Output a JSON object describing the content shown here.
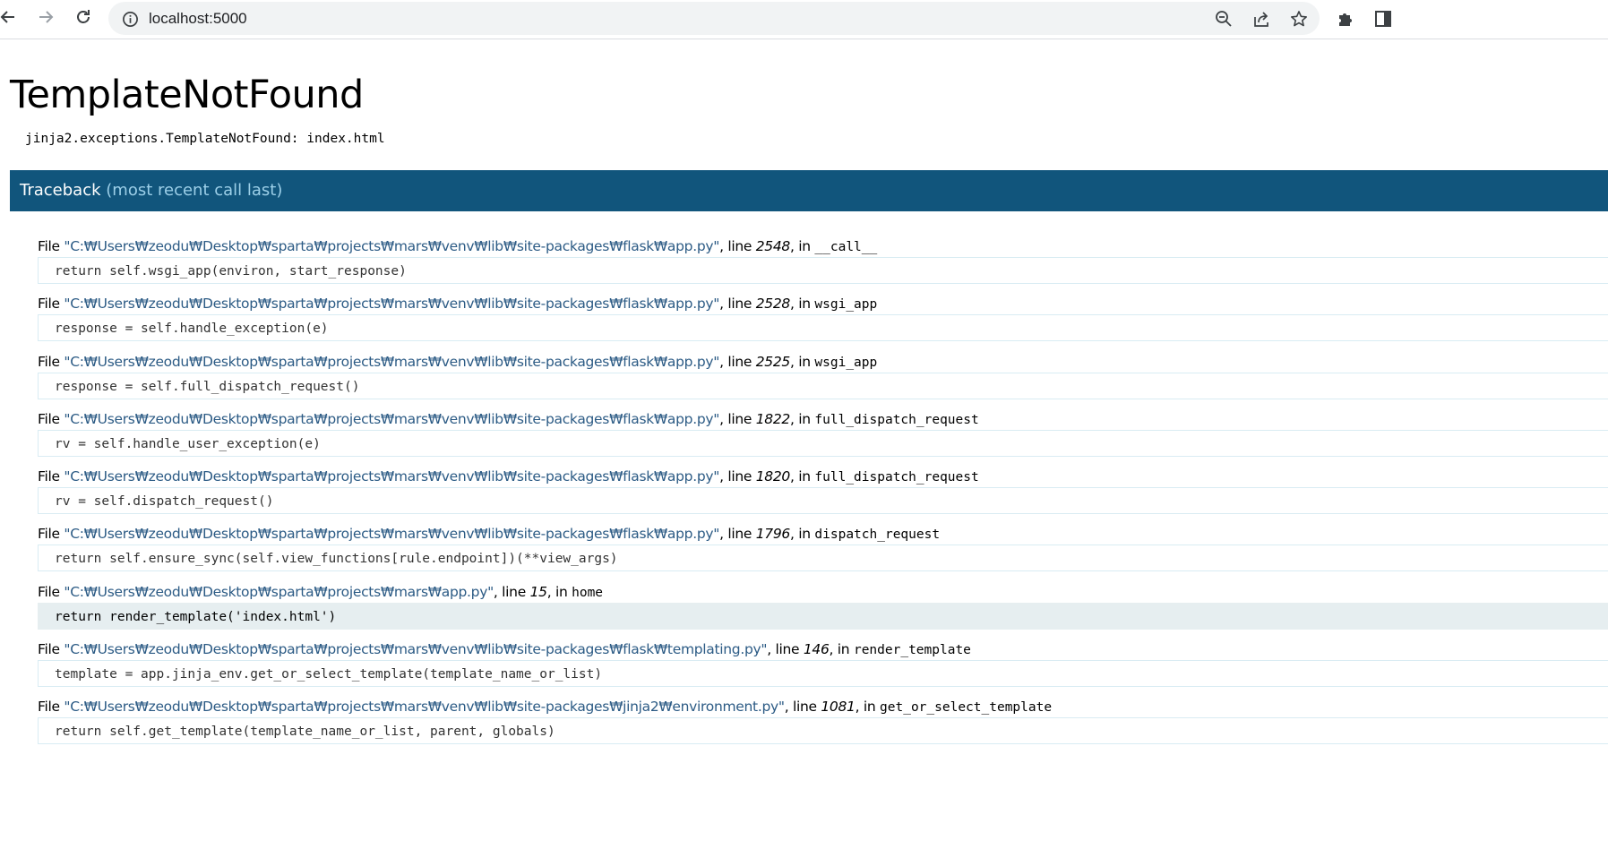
{
  "browser": {
    "url": "localhost:5000",
    "icons": {
      "back": "arrow-left-icon",
      "forward": "arrow-right-icon",
      "reload": "reload-icon",
      "site_info": "info-icon",
      "zoom": "zoom-out-icon",
      "share": "share-icon",
      "bookmark": "star-icon",
      "extensions": "puzzle-icon",
      "side_panel": "side-panel-icon"
    }
  },
  "error": {
    "title": "TemplateNotFound",
    "message": "jinja2.exceptions.TemplateNotFound: index.html"
  },
  "traceback": {
    "label": "Traceback",
    "note": "(most recent call last)",
    "frames": [
      {
        "file_prefix": "File ",
        "path": "\"C:₩Users₩zeodu₩Desktop₩sparta₩projects₩mars₩venv₩lib₩site-packages₩flask₩app.py\"",
        "line_label": ", line ",
        "line": "2548",
        "in_label": ", in ",
        "func": "__call__",
        "code": "return self.wsgi_app(environ, start_response)",
        "current": false
      },
      {
        "file_prefix": "File ",
        "path": "\"C:₩Users₩zeodu₩Desktop₩sparta₩projects₩mars₩venv₩lib₩site-packages₩flask₩app.py\"",
        "line_label": ", line ",
        "line": "2528",
        "in_label": ", in ",
        "func": "wsgi_app",
        "code": "response = self.handle_exception(e)",
        "current": false
      },
      {
        "file_prefix": "File ",
        "path": "\"C:₩Users₩zeodu₩Desktop₩sparta₩projects₩mars₩venv₩lib₩site-packages₩flask₩app.py\"",
        "line_label": ", line ",
        "line": "2525",
        "in_label": ", in ",
        "func": "wsgi_app",
        "code": "response = self.full_dispatch_request()",
        "current": false
      },
      {
        "file_prefix": "File ",
        "path": "\"C:₩Users₩zeodu₩Desktop₩sparta₩projects₩mars₩venv₩lib₩site-packages₩flask₩app.py\"",
        "line_label": ", line ",
        "line": "1822",
        "in_label": ", in ",
        "func": "full_dispatch_request",
        "code": "rv = self.handle_user_exception(e)",
        "current": false
      },
      {
        "file_prefix": "File ",
        "path": "\"C:₩Users₩zeodu₩Desktop₩sparta₩projects₩mars₩venv₩lib₩site-packages₩flask₩app.py\"",
        "line_label": ", line ",
        "line": "1820",
        "in_label": ", in ",
        "func": "full_dispatch_request",
        "code": "rv = self.dispatch_request()",
        "current": false
      },
      {
        "file_prefix": "File ",
        "path": "\"C:₩Users₩zeodu₩Desktop₩sparta₩projects₩mars₩venv₩lib₩site-packages₩flask₩app.py\"",
        "line_label": ", line ",
        "line": "1796",
        "in_label": ", in ",
        "func": "dispatch_request",
        "code": "return self.ensure_sync(self.view_functions[rule.endpoint])(**view_args)",
        "current": false
      },
      {
        "file_prefix": "File ",
        "path": "\"C:₩Users₩zeodu₩Desktop₩sparta₩projects₩mars₩app.py\"",
        "line_label": ", line ",
        "line": "15",
        "in_label": ", in ",
        "func": "home",
        "code": "return render_template('index.html')",
        "current": true
      },
      {
        "file_prefix": "File ",
        "path": "\"C:₩Users₩zeodu₩Desktop₩sparta₩projects₩mars₩venv₩lib₩site-packages₩flask₩templating.py\"",
        "line_label": ", line ",
        "line": "146",
        "in_label": ", in ",
        "func": "render_template",
        "code": "template = app.jinja_env.get_or_select_template(template_name_or_list)",
        "current": false
      },
      {
        "file_prefix": "File ",
        "path": "\"C:₩Users₩zeodu₩Desktop₩sparta₩projects₩mars₩venv₩lib₩site-packages₩jinja2₩environment.py\"",
        "line_label": ", line ",
        "line": "1081",
        "in_label": ", in ",
        "func": "get_or_select_template",
        "code": "return self.get_template(template_name_or_list, parent, globals)",
        "current": false
      }
    ]
  }
}
